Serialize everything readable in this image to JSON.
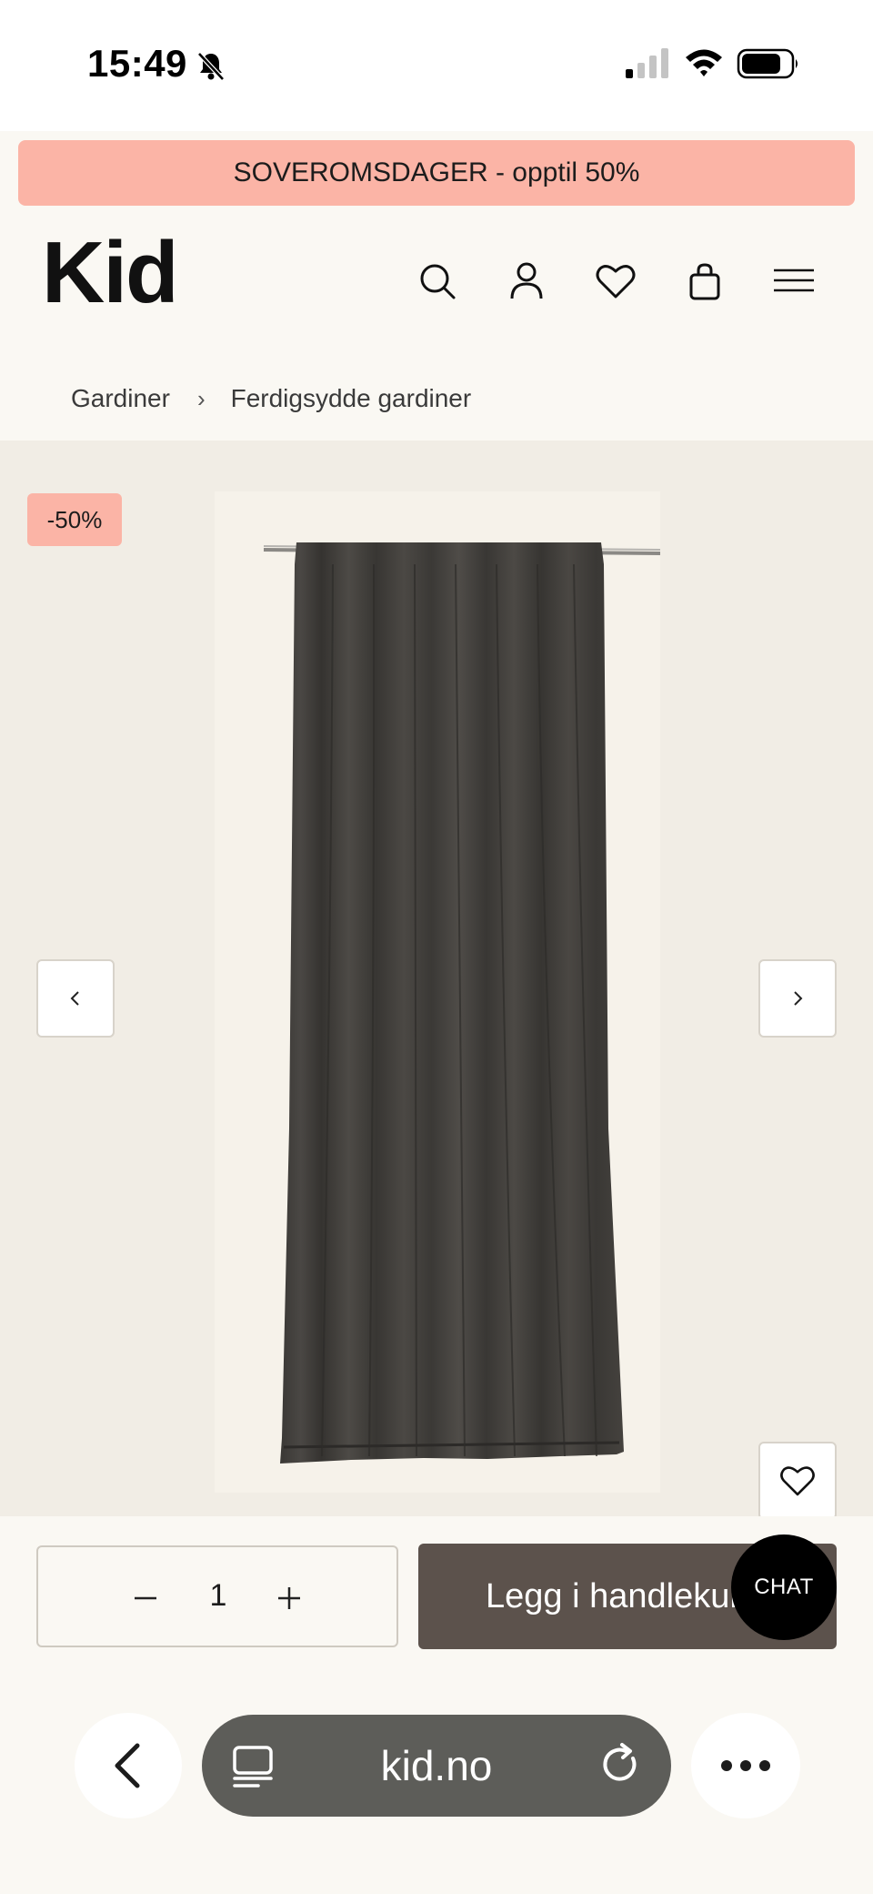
{
  "status_bar": {
    "time": "15:49",
    "icons": [
      "bell-slash-icon",
      "signal-icon",
      "wifi-icon",
      "battery-icon"
    ]
  },
  "promo_banner": {
    "text": "SOVEROMSDAGER - opptil 50%",
    "color": "#fbb4a6"
  },
  "header": {
    "logo": "Kid",
    "icons": [
      "search-icon",
      "account-icon",
      "wishlist-icon",
      "cart-icon",
      "menu-icon"
    ]
  },
  "breadcrumb": {
    "items": [
      "Gardiner",
      "Ferdigsydde gardiner"
    ],
    "separator": "›"
  },
  "gallery": {
    "discount_badge": "-50%",
    "prev_icon": "chevron-left-icon",
    "next_icon": "chevron-right-icon",
    "favorite_icon": "heart-icon"
  },
  "cart": {
    "quantity": "1",
    "add_button_label": "Legg i handlekurv",
    "button_color": "#5c524c"
  },
  "chat": {
    "label": "CHAT"
  },
  "browser": {
    "url": "kid.no",
    "icons": [
      "back-icon",
      "tabs-icon",
      "reload-icon",
      "more-icon"
    ]
  }
}
